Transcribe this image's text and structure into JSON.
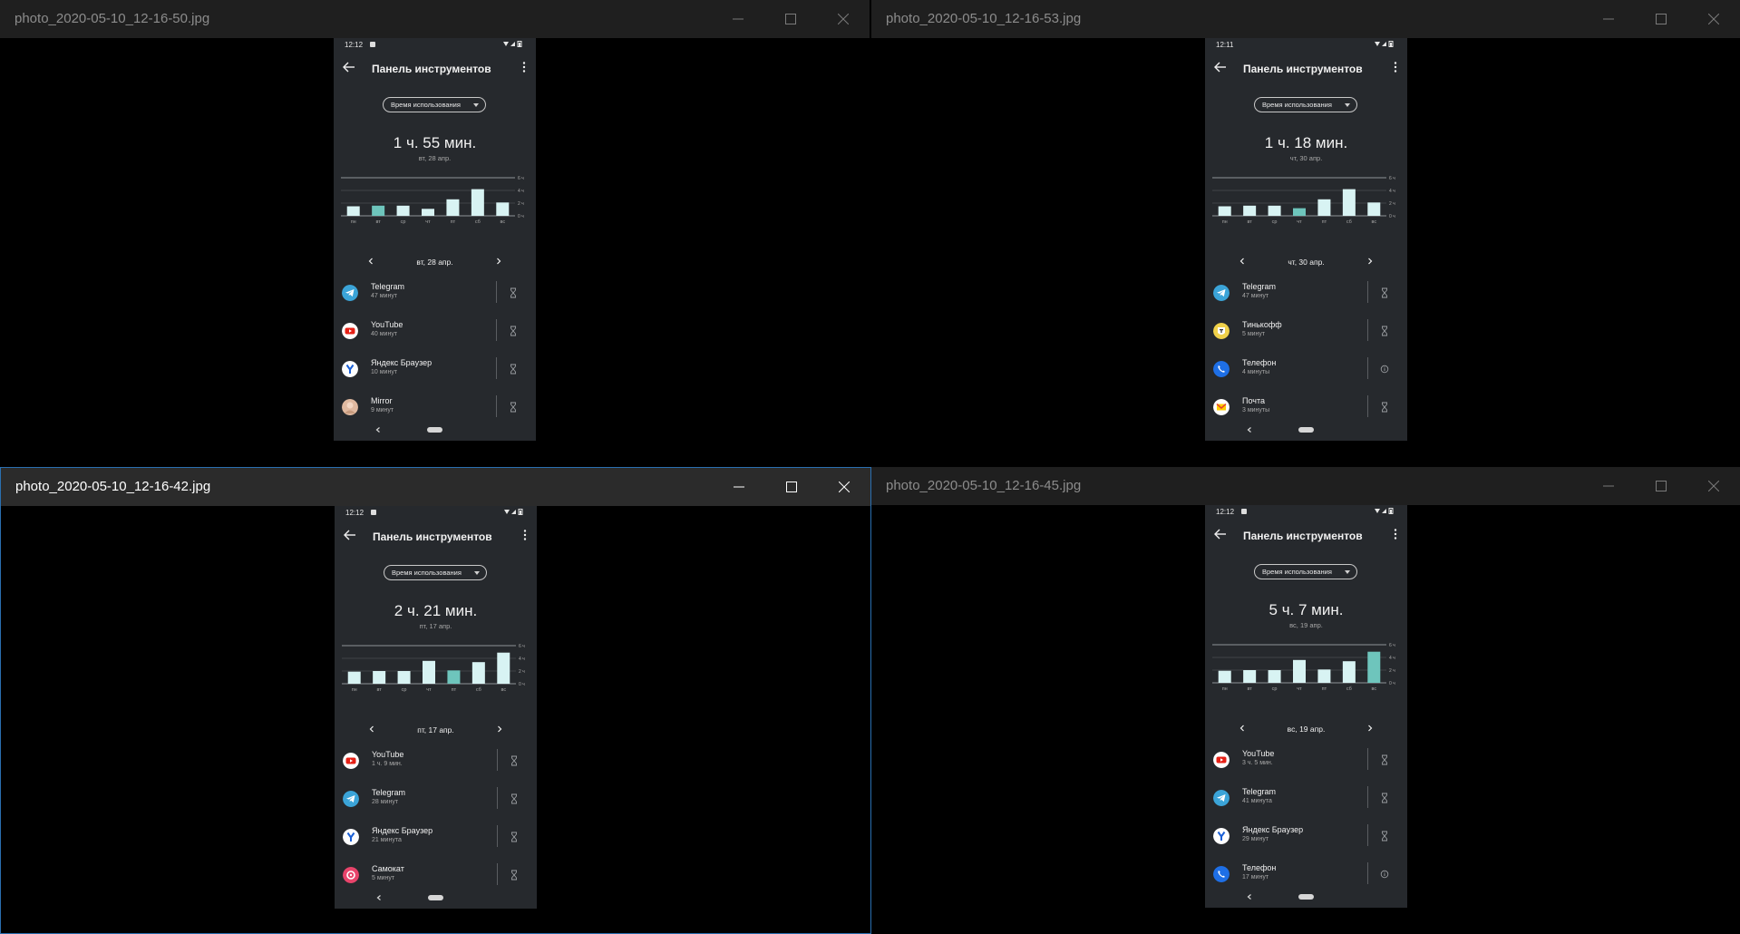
{
  "screen": {
    "status_time_default": "12:12",
    "app_title": "Панель инструментов",
    "dropdown_label": "Время использования",
    "day_labels": [
      "пн",
      "вт",
      "ср",
      "чт",
      "пт",
      "сб",
      "вс"
    ],
    "y_labels": [
      "6 ч",
      "4 ч",
      "2 ч",
      "0 ч"
    ],
    "colors": {
      "bar": "#d8f3f3",
      "bar_selected": "#6ec5bc",
      "phone_bg": "#26292d",
      "window_bg": "#000000",
      "titlebar": "#1f1f1f",
      "titlebar_active": "#2b2b2b",
      "active_border": "#2a6fb0"
    }
  },
  "windows": [
    {
      "title": "photo_2020-05-10_12-16-50.jpg",
      "active": false,
      "status_time": "12:12",
      "status_notification_icon": true,
      "total": "1 ч. 55 мин.",
      "date": "вт, 28 апр.",
      "nav_date": "вт, 28 апр.",
      "chart_data": {
        "type": "bar",
        "categories": [
          "пн",
          "вт",
          "ср",
          "чт",
          "пт",
          "сб",
          "вс"
        ],
        "values": [
          1.5,
          1.6,
          1.6,
          1.1,
          2.6,
          4.2,
          2.1
        ],
        "selected_index": 1,
        "ylim": [
          0,
          6
        ],
        "y_ticks": [
          "0 ч",
          "2 ч",
          "4 ч",
          "6 ч"
        ]
      },
      "apps": [
        {
          "name": "Telegram",
          "time": "47 минут",
          "icon": "telegram-icon",
          "action": "timer-icon"
        },
        {
          "name": "YouTube",
          "time": "40 минут",
          "icon": "youtube-icon",
          "action": "timer-icon"
        },
        {
          "name": "Яндекс Браузер",
          "time": "10 минут",
          "icon": "yandex-browser-icon",
          "action": "timer-icon"
        },
        {
          "name": "Mirror",
          "time": "9 минут",
          "icon": "mirror-icon",
          "action": "timer-icon"
        }
      ]
    },
    {
      "title": "photo_2020-05-10_12-16-53.jpg",
      "active": false,
      "status_time": "12:11",
      "status_notification_icon": false,
      "total": "1 ч. 18 мин.",
      "date": "чт, 30 апр.",
      "nav_date": "чт, 30 апр.",
      "chart_data": {
        "type": "bar",
        "categories": [
          "пн",
          "вт",
          "ср",
          "чт",
          "пт",
          "сб",
          "вс"
        ],
        "values": [
          1.5,
          1.6,
          1.6,
          1.2,
          2.6,
          4.2,
          2.1
        ],
        "selected_index": 3,
        "ylim": [
          0,
          6
        ],
        "y_ticks": [
          "0 ч",
          "2 ч",
          "4 ч",
          "6 ч"
        ]
      },
      "apps": [
        {
          "name": "Telegram",
          "time": "47 минут",
          "icon": "telegram-icon",
          "action": "timer-icon"
        },
        {
          "name": "Тинькофф",
          "time": "5 минут",
          "icon": "tinkoff-icon",
          "action": "timer-icon"
        },
        {
          "name": "Телефон",
          "time": "4 минуты",
          "icon": "phone-icon",
          "action": "info-icon"
        },
        {
          "name": "Почта",
          "time": "3 минуты",
          "icon": "mail-icon",
          "action": "timer-icon"
        }
      ]
    },
    {
      "title": "photo_2020-05-10_12-16-42.jpg",
      "active": true,
      "status_time": "12:12",
      "status_notification_icon": true,
      "total": "2 ч. 21 мин.",
      "date": "пт, 17 апр.",
      "nav_date": "пт, 17 апр.",
      "chart_data": {
        "type": "bar",
        "categories": [
          "пн",
          "вт",
          "ср",
          "чт",
          "пт",
          "сб",
          "вс"
        ],
        "values": [
          1.9,
          2.0,
          2.0,
          3.6,
          2.1,
          3.4,
          4.9
        ],
        "selected_index": 4,
        "ylim": [
          0,
          6
        ],
        "y_ticks": [
          "0 ч",
          "2 ч",
          "4 ч",
          "6 ч"
        ]
      },
      "apps": [
        {
          "name": "YouTube",
          "time": "1 ч. 9 мин.",
          "icon": "youtube-icon",
          "action": "timer-icon"
        },
        {
          "name": "Telegram",
          "time": "28 минут",
          "icon": "telegram-icon",
          "action": "timer-icon"
        },
        {
          "name": "Яндекс Браузер",
          "time": "21 минута",
          "icon": "yandex-browser-icon",
          "action": "timer-icon"
        },
        {
          "name": "Самокат",
          "time": "5 минут",
          "icon": "samokat-icon",
          "action": "timer-icon"
        }
      ]
    },
    {
      "title": "photo_2020-05-10_12-16-45.jpg",
      "active": false,
      "status_time": "12:12",
      "status_notification_icon": true,
      "total": "5 ч. 7 мин.",
      "date": "вс, 19 апр.",
      "nav_date": "вс, 19 апр.",
      "chart_data": {
        "type": "bar",
        "categories": [
          "пн",
          "вт",
          "ср",
          "чт",
          "пт",
          "сб",
          "вс"
        ],
        "values": [
          1.9,
          2.0,
          2.0,
          3.6,
          2.1,
          3.4,
          4.9
        ],
        "selected_index": 6,
        "ylim": [
          0,
          6
        ],
        "y_ticks": [
          "0 ч",
          "2 ч",
          "4 ч",
          "6 ч"
        ]
      },
      "apps": [
        {
          "name": "YouTube",
          "time": "3 ч. 5 мин.",
          "icon": "youtube-icon",
          "action": "timer-icon"
        },
        {
          "name": "Telegram",
          "time": "41 минута",
          "icon": "telegram-icon",
          "action": "timer-icon"
        },
        {
          "name": "Яндекс Браузер",
          "time": "29 минут",
          "icon": "yandex-browser-icon",
          "action": "timer-icon"
        },
        {
          "name": "Телефон",
          "time": "17 минут",
          "icon": "phone-icon",
          "action": "info-icon"
        }
      ]
    }
  ]
}
